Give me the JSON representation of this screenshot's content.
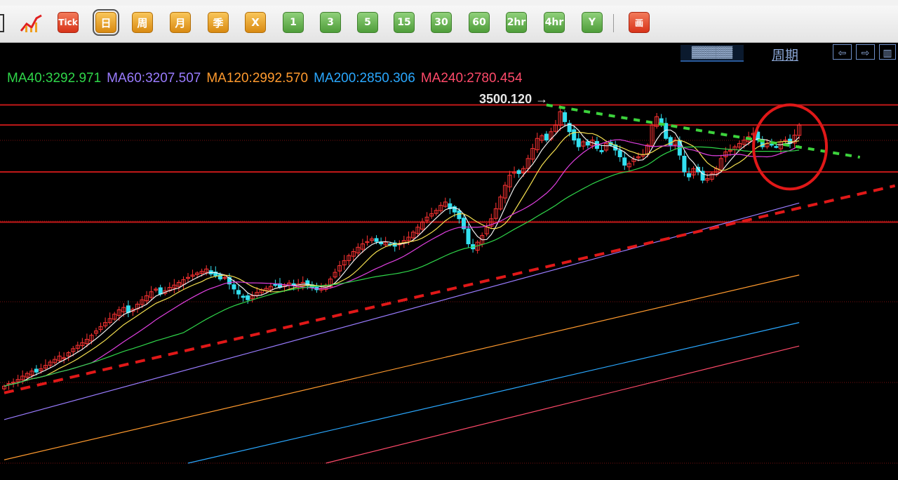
{
  "toolbar": {
    "buttons": [
      {
        "label": "Tick",
        "style": "red"
      },
      {
        "label": "日",
        "style": "gold"
      },
      {
        "label": "周",
        "style": "gold"
      },
      {
        "label": "月",
        "style": "gold"
      },
      {
        "label": "季",
        "style": "gold"
      },
      {
        "label": "X",
        "style": "gold"
      },
      {
        "label": "1",
        "style": "green"
      },
      {
        "label": "3",
        "style": "green"
      },
      {
        "label": "5",
        "style": "green"
      },
      {
        "label": "15",
        "style": "green"
      },
      {
        "label": "30",
        "style": "green"
      },
      {
        "label": "60",
        "style": "green"
      },
      {
        "label": "2hr",
        "style": "green"
      },
      {
        "label": "4hr",
        "style": "green"
      },
      {
        "label": "Y",
        "style": "green"
      },
      {
        "label": "画",
        "style": "red"
      }
    ],
    "selected": "日"
  },
  "header": {
    "period_link": "周期",
    "nav_icons": [
      "scroll-left-icon",
      "scroll-right-icon",
      "layout-icon"
    ]
  },
  "ma_legend": [
    {
      "text": "MA40:3292.971",
      "color": "#2fd64a"
    },
    {
      "text": "MA60:3207.507",
      "color": "#9a7cff"
    },
    {
      "text": "MA120:2992.570",
      "color": "#ff9a2e"
    },
    {
      "text": "MA200:2850.306",
      "color": "#2aa8ff"
    },
    {
      "text": "MA240:2780.454",
      "color": "#ff4a6a"
    }
  ],
  "chart_data": {
    "type": "candlestick",
    "period": "日",
    "price_range": [
      2430,
      3520
    ],
    "peak": {
      "value": 3500.12,
      "label": "3500.120"
    },
    "colors": {
      "up": "#ff3333",
      "down": "#33e0f0",
      "background": "#000000"
    },
    "closes": [
      2660,
      2668,
      2672,
      2680,
      2690,
      2698,
      2705,
      2702,
      2712,
      2722,
      2732,
      2740,
      2750,
      2745,
      2760,
      2772,
      2782,
      2790,
      2800,
      2812,
      2825,
      2838,
      2850,
      2862,
      2875,
      2888,
      2895,
      2880,
      2890,
      2905,
      2918,
      2930,
      2942,
      2950,
      2935,
      2945,
      2955,
      2962,
      2970,
      2978,
      2985,
      2992,
      2998,
      3003,
      3010,
      2995,
      2990,
      2980,
      2985,
      2965,
      2950,
      2935,
      2925,
      2918,
      2930,
      2940,
      2948,
      2952,
      2958,
      2962,
      2955,
      2962,
      2968,
      2960,
      2965,
      2970,
      2960,
      2955,
      2948,
      2952,
      2962,
      2980,
      3000,
      3020,
      3035,
      3050,
      3062,
      3075,
      3085,
      3092,
      3100,
      3092,
      3085,
      3090,
      3082,
      3078,
      3085,
      3095,
      3105,
      3120,
      3135,
      3150,
      3165,
      3175,
      3185,
      3200,
      3210,
      3190,
      3180,
      3160,
      3130,
      3085,
      3070,
      3090,
      3110,
      3135,
      3160,
      3190,
      3225,
      3260,
      3290,
      3300,
      3295,
      3310,
      3340,
      3370,
      3400,
      3408,
      3395,
      3420,
      3440,
      3480,
      3450,
      3420,
      3395,
      3375,
      3390,
      3380,
      3395,
      3370,
      3360,
      3385,
      3380,
      3365,
      3345,
      3320,
      3325,
      3338,
      3345,
      3352,
      3380,
      3440,
      3465,
      3440,
      3400,
      3380,
      3395,
      3350,
      3300,
      3285,
      3310,
      3300,
      3275,
      3280,
      3295,
      3310,
      3340,
      3360,
      3365,
      3375,
      3385,
      3395,
      3405,
      3415,
      3395,
      3375,
      3385,
      3380,
      3375,
      3390,
      3395,
      3385,
      3410,
      3440
    ],
    "overlays": {
      "horizontal_levels": [
        3500,
        3440,
        3300,
        3150
      ],
      "resistance_trendline": [
        [
          118,
          3500
        ],
        [
          174,
          3260
        ]
      ],
      "support_trendline": [
        [
          0,
          2640
        ],
        [
          174,
          3290
        ]
      ]
    },
    "annotation": "circle around latest candles"
  }
}
